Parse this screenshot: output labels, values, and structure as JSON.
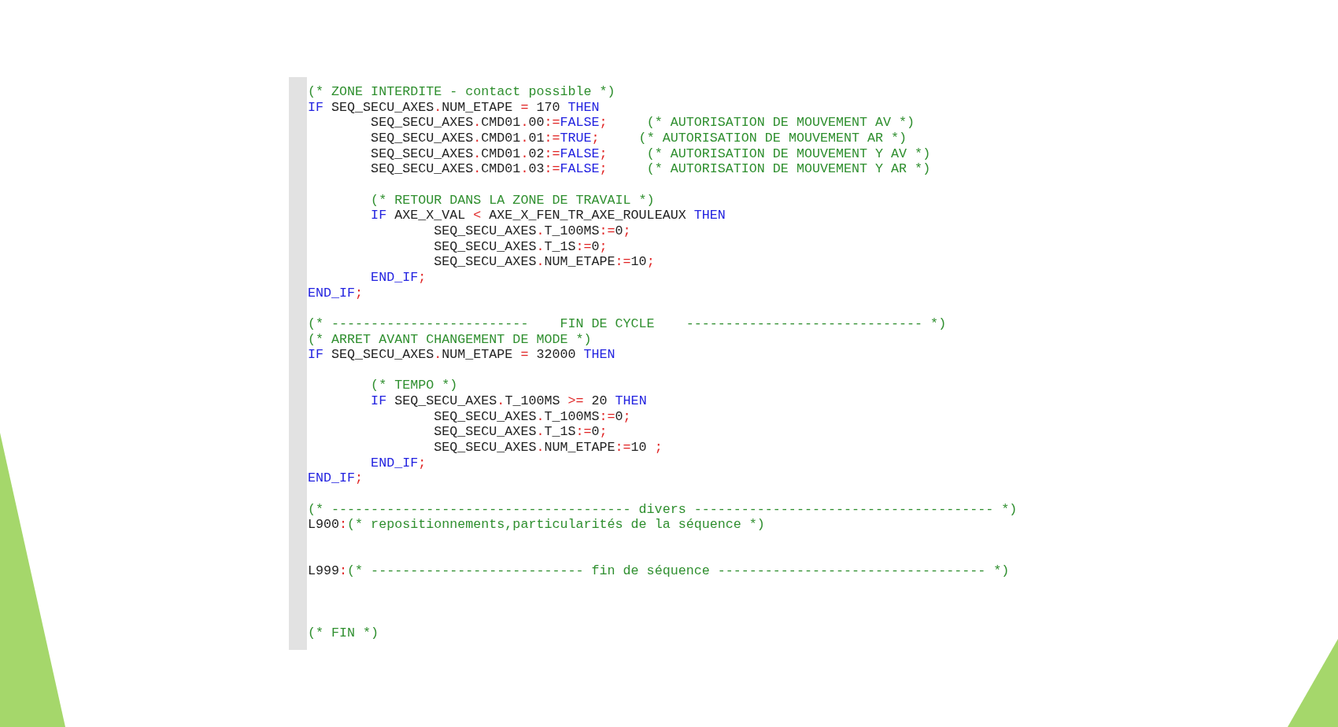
{
  "code_editor": {
    "lines": [
      {
        "segments": [
          {
            "kind": "comment",
            "text": "(* ZONE INTERDITE - contact possible *)"
          }
        ]
      },
      {
        "segments": [
          {
            "kind": "keyword",
            "text": "IF"
          },
          {
            "kind": "ident",
            "text": " SEQ_SECU_AXES"
          },
          {
            "kind": "op",
            "text": "."
          },
          {
            "kind": "ident",
            "text": "NUM_ETAPE "
          },
          {
            "kind": "op",
            "text": "="
          },
          {
            "kind": "ident",
            "text": " 170 "
          },
          {
            "kind": "keyword",
            "text": "THEN"
          }
        ]
      },
      {
        "segments": [
          {
            "kind": "ident",
            "text": "        SEQ_SECU_AXES"
          },
          {
            "kind": "op",
            "text": "."
          },
          {
            "kind": "ident",
            "text": "CMD01"
          },
          {
            "kind": "op",
            "text": "."
          },
          {
            "kind": "ident",
            "text": "00"
          },
          {
            "kind": "op",
            "text": ":="
          },
          {
            "kind": "keyword",
            "text": "FALSE"
          },
          {
            "kind": "op",
            "text": ";"
          },
          {
            "kind": "comment",
            "text": "     (* AUTORISATION DE MOUVEMENT AV *)"
          }
        ]
      },
      {
        "segments": [
          {
            "kind": "ident",
            "text": "        SEQ_SECU_AXES"
          },
          {
            "kind": "op",
            "text": "."
          },
          {
            "kind": "ident",
            "text": "CMD01"
          },
          {
            "kind": "op",
            "text": "."
          },
          {
            "kind": "ident",
            "text": "01"
          },
          {
            "kind": "op",
            "text": ":="
          },
          {
            "kind": "keyword",
            "text": "TRUE"
          },
          {
            "kind": "op",
            "text": ";"
          },
          {
            "kind": "comment",
            "text": "     (* AUTORISATION DE MOUVEMENT AR *)"
          }
        ]
      },
      {
        "segments": [
          {
            "kind": "ident",
            "text": "        SEQ_SECU_AXES"
          },
          {
            "kind": "op",
            "text": "."
          },
          {
            "kind": "ident",
            "text": "CMD01"
          },
          {
            "kind": "op",
            "text": "."
          },
          {
            "kind": "ident",
            "text": "02"
          },
          {
            "kind": "op",
            "text": ":="
          },
          {
            "kind": "keyword",
            "text": "FALSE"
          },
          {
            "kind": "op",
            "text": ";"
          },
          {
            "kind": "comment",
            "text": "     (* AUTORISATION DE MOUVEMENT Y AV *)"
          }
        ]
      },
      {
        "segments": [
          {
            "kind": "ident",
            "text": "        SEQ_SECU_AXES"
          },
          {
            "kind": "op",
            "text": "."
          },
          {
            "kind": "ident",
            "text": "CMD01"
          },
          {
            "kind": "op",
            "text": "."
          },
          {
            "kind": "ident",
            "text": "03"
          },
          {
            "kind": "op",
            "text": ":="
          },
          {
            "kind": "keyword",
            "text": "FALSE"
          },
          {
            "kind": "op",
            "text": ";"
          },
          {
            "kind": "comment",
            "text": "     (* AUTORISATION DE MOUVEMENT Y AR *)"
          }
        ]
      },
      {
        "kind": "blank"
      },
      {
        "segments": [
          {
            "kind": "comment",
            "text": "        (* RETOUR DANS LA ZONE DE TRAVAIL *)"
          }
        ]
      },
      {
        "segments": [
          {
            "kind": "keyword",
            "text": "        IF"
          },
          {
            "kind": "ident",
            "text": " AXE_X_VAL "
          },
          {
            "kind": "op",
            "text": "<"
          },
          {
            "kind": "ident",
            "text": " AXE_X_FEN_TR_AXE_ROULEAUX "
          },
          {
            "kind": "keyword",
            "text": "THEN"
          }
        ]
      },
      {
        "segments": [
          {
            "kind": "ident",
            "text": "                SEQ_SECU_AXES"
          },
          {
            "kind": "op",
            "text": "."
          },
          {
            "kind": "ident",
            "text": "T_100MS"
          },
          {
            "kind": "op",
            "text": ":="
          },
          {
            "kind": "ident",
            "text": "0"
          },
          {
            "kind": "op",
            "text": ";"
          }
        ]
      },
      {
        "segments": [
          {
            "kind": "ident",
            "text": "                SEQ_SECU_AXES"
          },
          {
            "kind": "op",
            "text": "."
          },
          {
            "kind": "ident",
            "text": "T_1S"
          },
          {
            "kind": "op",
            "text": ":="
          },
          {
            "kind": "ident",
            "text": "0"
          },
          {
            "kind": "op",
            "text": ";"
          }
        ]
      },
      {
        "segments": [
          {
            "kind": "ident",
            "text": "                SEQ_SECU_AXES"
          },
          {
            "kind": "op",
            "text": "."
          },
          {
            "kind": "ident",
            "text": "NUM_ETAPE"
          },
          {
            "kind": "op",
            "text": ":="
          },
          {
            "kind": "ident",
            "text": "10"
          },
          {
            "kind": "op",
            "text": ";"
          }
        ]
      },
      {
        "segments": [
          {
            "kind": "keyword",
            "text": "        END_IF"
          },
          {
            "kind": "op",
            "text": ";"
          }
        ]
      },
      {
        "segments": [
          {
            "kind": "keyword",
            "text": "END_IF"
          },
          {
            "kind": "op",
            "text": ";"
          }
        ]
      },
      {
        "kind": "blank"
      },
      {
        "segments": [
          {
            "kind": "comment",
            "text": "(* -------------------------    FIN DE CYCLE    ------------------------------ *)"
          }
        ]
      },
      {
        "segments": [
          {
            "kind": "comment",
            "text": "(* ARRET AVANT CHANGEMENT DE MODE *)"
          }
        ]
      },
      {
        "segments": [
          {
            "kind": "keyword",
            "text": "IF"
          },
          {
            "kind": "ident",
            "text": " SEQ_SECU_AXES"
          },
          {
            "kind": "op",
            "text": "."
          },
          {
            "kind": "ident",
            "text": "NUM_ETAPE "
          },
          {
            "kind": "op",
            "text": "="
          },
          {
            "kind": "ident",
            "text": " 32000 "
          },
          {
            "kind": "keyword",
            "text": "THEN"
          }
        ]
      },
      {
        "kind": "blank"
      },
      {
        "segments": [
          {
            "kind": "comment",
            "text": "        (* TEMPO *)"
          }
        ]
      },
      {
        "segments": [
          {
            "kind": "keyword",
            "text": "        IF"
          },
          {
            "kind": "ident",
            "text": " SEQ_SECU_AXES"
          },
          {
            "kind": "op",
            "text": "."
          },
          {
            "kind": "ident",
            "text": "T_100MS "
          },
          {
            "kind": "op",
            "text": ">="
          },
          {
            "kind": "ident",
            "text": " 20 "
          },
          {
            "kind": "keyword",
            "text": "THEN"
          }
        ]
      },
      {
        "segments": [
          {
            "kind": "ident",
            "text": "                SEQ_SECU_AXES"
          },
          {
            "kind": "op",
            "text": "."
          },
          {
            "kind": "ident",
            "text": "T_100MS"
          },
          {
            "kind": "op",
            "text": ":="
          },
          {
            "kind": "ident",
            "text": "0"
          },
          {
            "kind": "op",
            "text": ";"
          }
        ]
      },
      {
        "segments": [
          {
            "kind": "ident",
            "text": "                SEQ_SECU_AXES"
          },
          {
            "kind": "op",
            "text": "."
          },
          {
            "kind": "ident",
            "text": "T_1S"
          },
          {
            "kind": "op",
            "text": ":="
          },
          {
            "kind": "ident",
            "text": "0"
          },
          {
            "kind": "op",
            "text": ";"
          }
        ]
      },
      {
        "segments": [
          {
            "kind": "ident",
            "text": "                SEQ_SECU_AXES"
          },
          {
            "kind": "op",
            "text": "."
          },
          {
            "kind": "ident",
            "text": "NUM_ETAPE"
          },
          {
            "kind": "op",
            "text": ":="
          },
          {
            "kind": "ident",
            "text": "10 "
          },
          {
            "kind": "op",
            "text": ";"
          }
        ]
      },
      {
        "segments": [
          {
            "kind": "keyword",
            "text": "        END_IF"
          },
          {
            "kind": "op",
            "text": ";"
          }
        ]
      },
      {
        "segments": [
          {
            "kind": "keyword",
            "text": "END_IF"
          },
          {
            "kind": "op",
            "text": ";"
          }
        ]
      },
      {
        "kind": "blank"
      },
      {
        "segments": [
          {
            "kind": "comment",
            "text": "(* -------------------------------------- divers -------------------------------------- *)"
          }
        ]
      },
      {
        "segments": [
          {
            "kind": "ident",
            "text": "L900"
          },
          {
            "kind": "op",
            "text": ":"
          },
          {
            "kind": "comment",
            "text": "(* repositionnements,particularités de la séquence *)"
          }
        ]
      },
      {
        "kind": "blank"
      },
      {
        "kind": "blank"
      },
      {
        "segments": [
          {
            "kind": "ident",
            "text": "L999"
          },
          {
            "kind": "op",
            "text": ":"
          },
          {
            "kind": "comment",
            "text": "(* --------------------------- fin de séquence ---------------------------------- *)"
          }
        ]
      },
      {
        "kind": "blank"
      },
      {
        "kind": "blank"
      },
      {
        "kind": "blank"
      },
      {
        "segments": [
          {
            "kind": "comment",
            "text": "(* FIN *)"
          }
        ]
      }
    ]
  }
}
